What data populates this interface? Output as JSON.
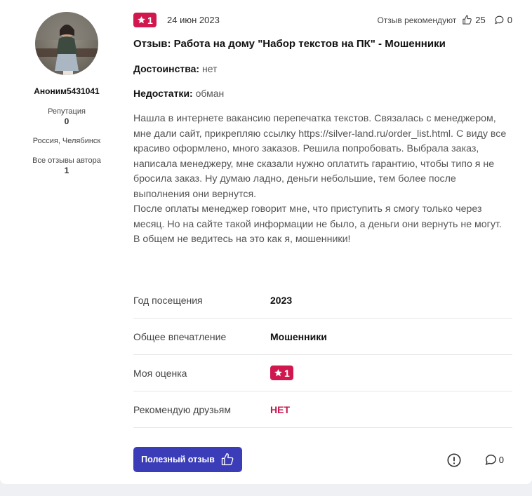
{
  "author": {
    "name": "Аноним5431041",
    "reputation_label": "Репутация",
    "reputation_value": "0",
    "location": "Россия, Челябинск",
    "all_reviews_label": "Все отзывы автора",
    "all_reviews_count": "1"
  },
  "review": {
    "rating": "1",
    "date": "24 июн 2023",
    "recommend_label": "Отзыв рекомендуют",
    "likes": "25",
    "comments": "0",
    "title": "Отзыв: Работа на дому \"Набор текстов на ПК\" - Мошенники",
    "pros_label": "Достоинства:",
    "pros_value": "нет",
    "cons_label": "Недостатки:",
    "cons_value": "обман",
    "paragraphs": [
      "Нашла в интернете вакансию перепечатка текстов. Связалась с менеджером, мне дали сайт, прикрепляю ссылку https://silver-land.ru/order_list.html. С виду все красиво оформлено, много заказов. Решила попробовать. Выбрала заказ, написала менеджеру, мне сказали нужно оплатить гарантию, чтобы типо я не бросила заказ. Ну думаю ладно, деньги небольшие, тем более после выполнения они вернутся.",
      "После оплаты менеджер говорит мне, что приступить я смогу только через месяц. Но на сайте такой информации не было, а деньги они вернуть не могут.",
      "В общем не ведитесь на это как я, мошенники!"
    ]
  },
  "facts": {
    "visit_year_label": "Год посещения",
    "visit_year_value": "2023",
    "impression_label": "Общее впечатление",
    "impression_value": "Мошенники",
    "my_rating_label": "Моя оценка",
    "my_rating_value": "1",
    "recommend_label": "Рекомендую друзьям",
    "recommend_value": "НЕТ"
  },
  "actions": {
    "useful_label": "Полезный отзыв",
    "comments_count": "0"
  },
  "icons": {
    "rating": "star-icon",
    "like": "thumbs-up-icon",
    "comment": "comment-bubble-icon",
    "report": "exclamation-circle-icon"
  },
  "colors": {
    "accent_red": "#d0174e",
    "button_blue": "#3b3cb8"
  }
}
